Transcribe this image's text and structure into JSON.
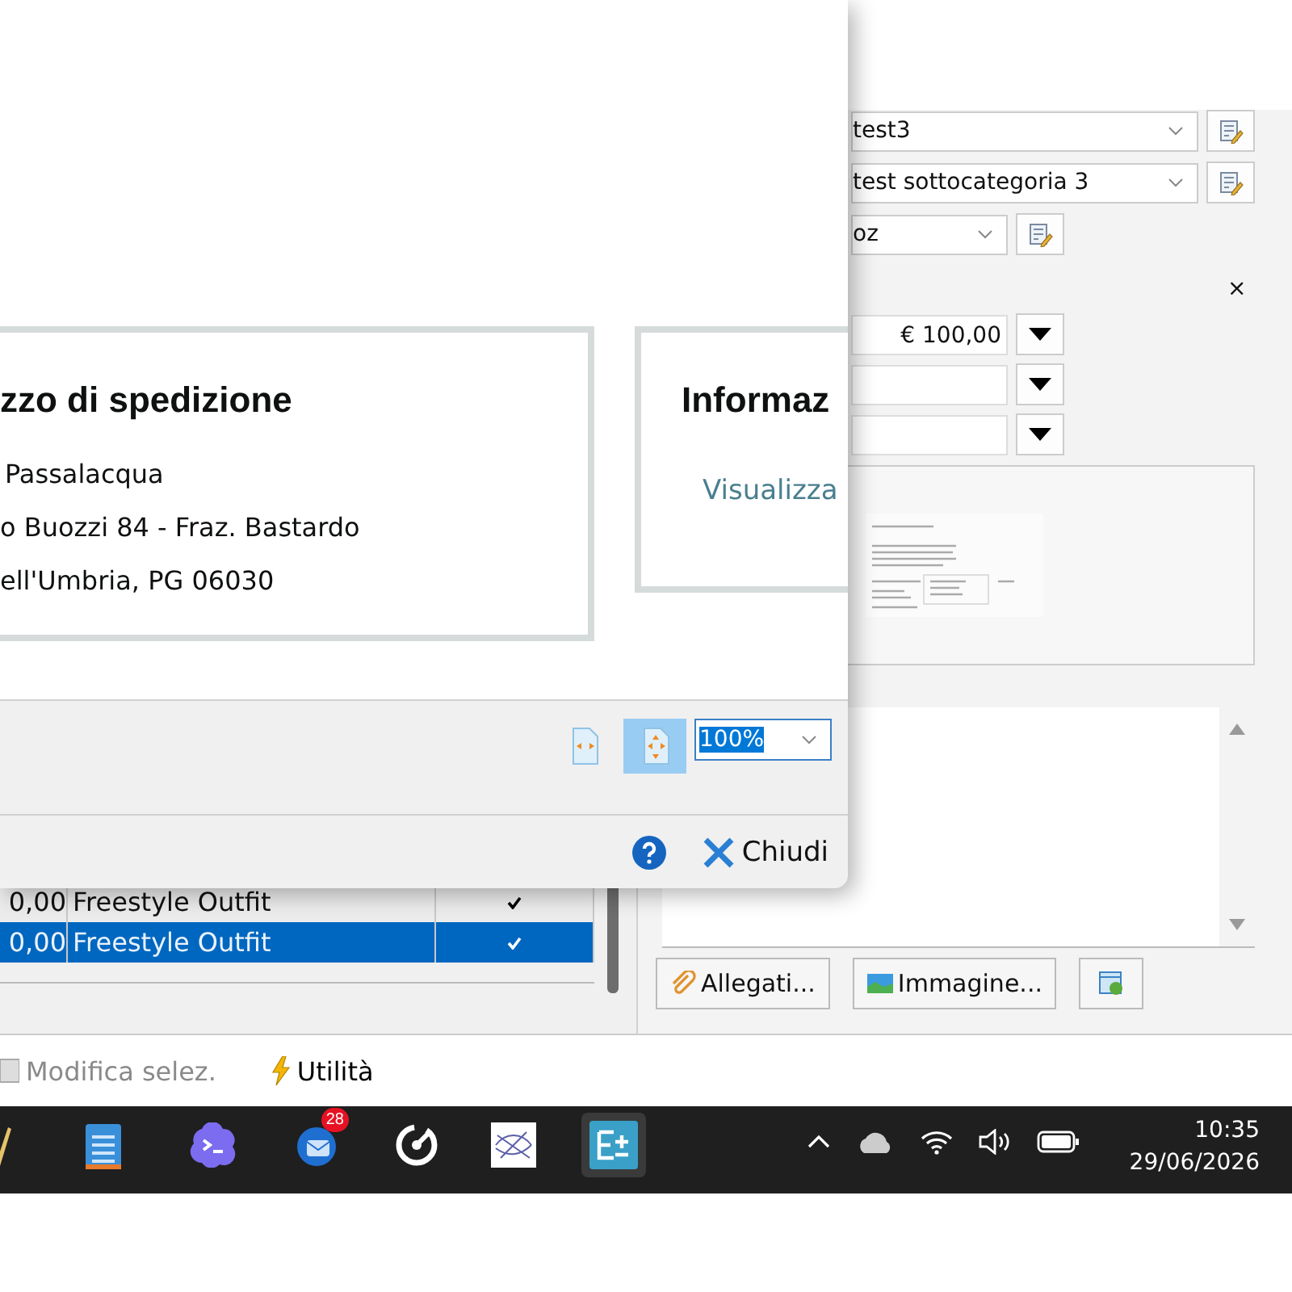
{
  "print_preview": {
    "address_card": {
      "title": "zzo di spedizione",
      "lines": [
        "Passalacqua",
        "o Buozzi 84 - Fraz. Bastardo",
        "ell'Umbria, PG 06030"
      ]
    },
    "info_card": {
      "title": "Informaz",
      "link": "Visualizza"
    },
    "view_buttons": [
      {
        "selected": false
      },
      {
        "selected": true
      }
    ],
    "zoom": {
      "value": "100%"
    },
    "close_button": "Chiudi"
  },
  "table": {
    "rows": [
      {
        "amount": "0,00",
        "description": "Freestyle Outfit",
        "checked": true,
        "selected": false
      },
      {
        "amount": "0,00",
        "description": "Freestyle Outfit",
        "checked": true,
        "selected": true
      }
    ]
  },
  "details": {
    "category": "test3",
    "subcategory": "test sottocategoria 3",
    "field_3": "oz",
    "close_mark": "×",
    "price_fields": [
      {
        "value": "€ 100,00"
      }
    ],
    "buttons": [
      "Allegati...",
      "Immagine..."
    ]
  },
  "status_bar": {
    "items": [
      {
        "label": "Modifica selez.",
        "disabled": true
      },
      {
        "label": "Utilità",
        "disabled": false
      }
    ]
  },
  "taskbar": {
    "apps": [
      {
        "kind": "pen",
        "active": false
      },
      {
        "kind": "notes",
        "active": false
      },
      {
        "kind": "terminal",
        "active": false
      },
      {
        "kind": "mail",
        "active": false,
        "badge": "28"
      },
      {
        "kind": "gauge",
        "active": false
      },
      {
        "kind": "sketch",
        "active": false
      },
      {
        "kind": "editor",
        "active": true
      }
    ],
    "time": "10:35",
    "date": "29/06/2026"
  }
}
